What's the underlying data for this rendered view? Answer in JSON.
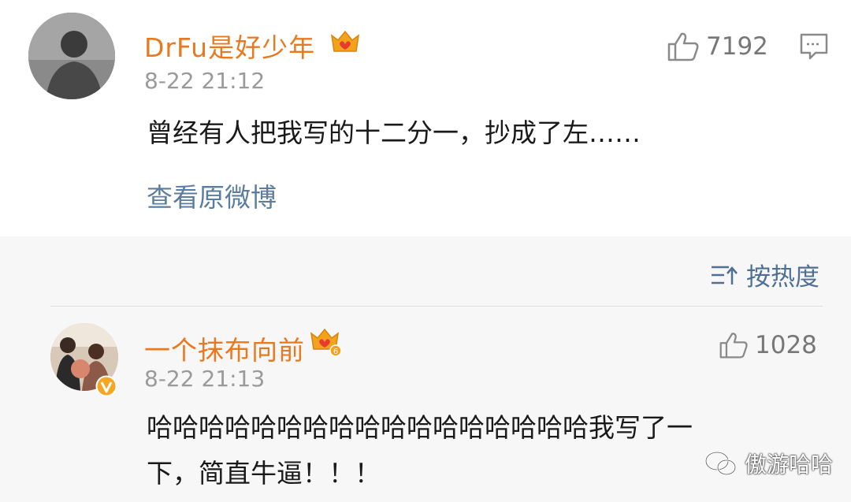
{
  "post": {
    "username": "DrFu是好少年",
    "timestamp": "8-22 21:12",
    "content": "曾经有人把我写的十二分一，抄成了左……",
    "likes": "7192",
    "view_original": "查看原微博"
  },
  "sort": {
    "label": "按热度",
    "icon": "sort-icon"
  },
  "comments": [
    {
      "username": "一个抹布向前",
      "timestamp": "8-22 21:13",
      "content_line1": "哈哈哈哈哈哈哈哈哈哈哈哈哈哈哈哈哈我写了一",
      "content_line2": "下，简直牛逼！！！",
      "likes": "1028",
      "member_level": "6"
    }
  ],
  "watermark": {
    "text": "傲游哈哈"
  },
  "colors": {
    "username": "#e8791f",
    "link": "#5b7da0",
    "crown": "#f3a21d",
    "crown_accent": "#e83b2f",
    "verified": "#f5a623"
  }
}
